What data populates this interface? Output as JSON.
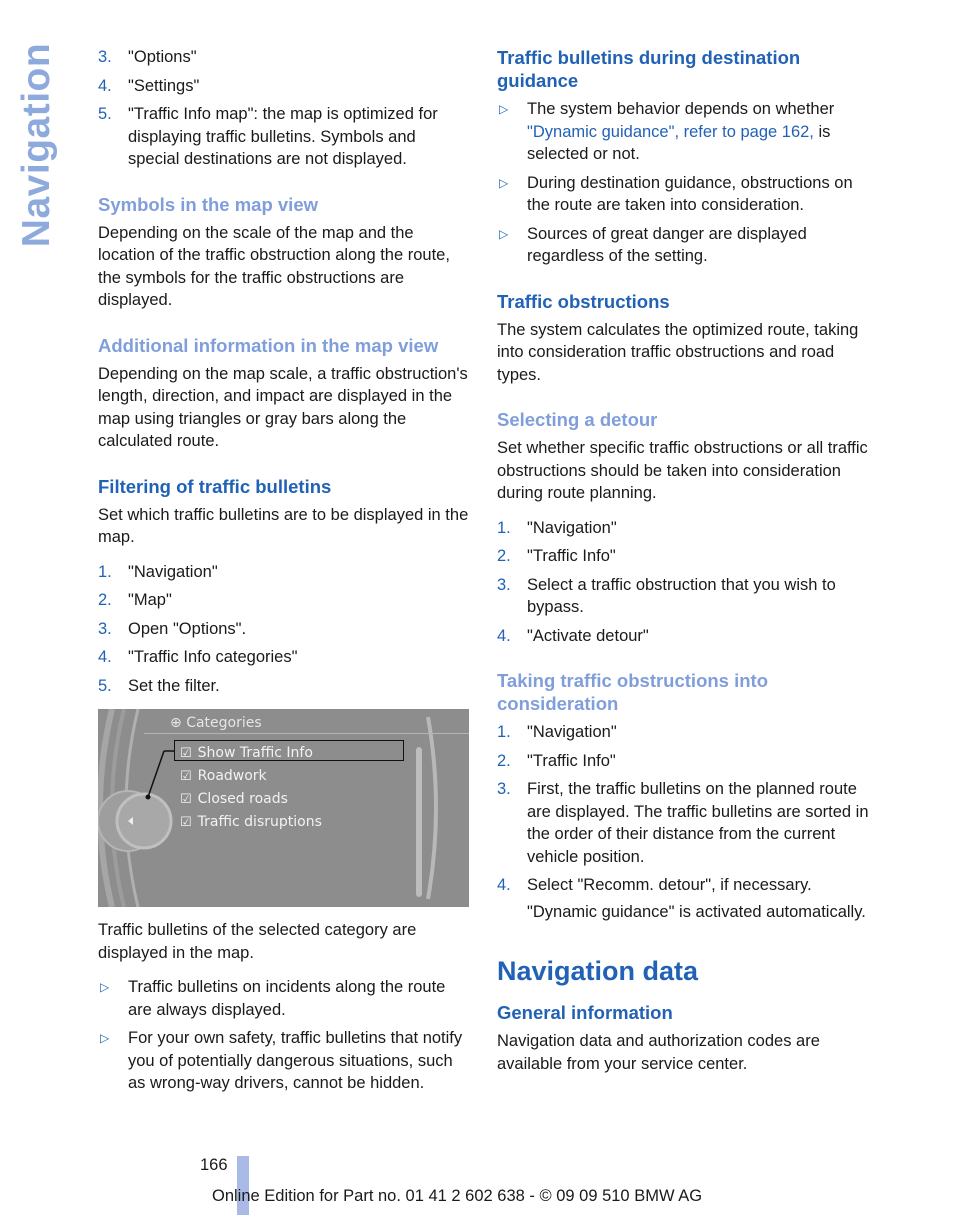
{
  "side_tab": "Navigation",
  "left": {
    "list_top": [
      {
        "num": "3.",
        "text": "\"Options\""
      },
      {
        "num": "4.",
        "text": "\"Settings\""
      },
      {
        "num": "5.",
        "text": "\"Traffic Info map\": the map is optimized for displaying traffic bulletins. Symbols and special destinations are not displayed."
      }
    ],
    "symbols_heading": "Symbols in the map view",
    "symbols_text": "Depending on the scale of the map and the location of the traffic obstruction along the route, the symbols for the traffic obstructions are displayed.",
    "additional_heading": "Additional information in the map view",
    "additional_text": "Depending on the map scale, a traffic obstruction's length, direction, and impact are displayed in the map using triangles or gray bars along the calculated route.",
    "filtering_heading": "Filtering of traffic bulletins",
    "filtering_text": "Set which traffic bulletins are to be displayed in the map.",
    "filter_steps": [
      {
        "num": "1.",
        "text": "\"Navigation\""
      },
      {
        "num": "2.",
        "text": "\"Map\""
      },
      {
        "num": "3.",
        "text": "Open \"Options\"."
      },
      {
        "num": "4.",
        "text": "\"Traffic Info categories\""
      },
      {
        "num": "5.",
        "text": "Set the filter."
      }
    ],
    "screen": {
      "title": "Categories",
      "items": [
        "Show Traffic Info",
        "Roadwork",
        "Closed roads",
        "Traffic disruptions"
      ]
    },
    "after_screen_text": "Traffic bulletins of the selected category are displayed in the map.",
    "bullets": [
      "Traffic bulletins on incidents along the route are always displayed.",
      "For your own safety, traffic bulletins that notify you of potentially dangerous situations, such as wrong-way drivers, cannot be hidden."
    ]
  },
  "right": {
    "guidance_heading": "Traffic bulletins during destination guidance",
    "guidance_b1_pre": "The system behavior depends on whether ",
    "guidance_b1_link": "\"Dynamic guidance\", refer to page 162,",
    "guidance_b1_post": " is selected or not.",
    "guidance_b2": "During destination guidance, obstructions on the route are taken into consideration.",
    "guidance_b3": "Sources of great danger are displayed regardless of the setting.",
    "obstructions_heading": "Traffic obstructions",
    "obstructions_text": "The system calculates the optimized route, taking into consideration traffic obstructions and road types.",
    "detour_heading": "Selecting a detour",
    "detour_text": "Set whether specific traffic obstructions or all traffic obstructions should be taken into consideration during route planning.",
    "detour_steps": [
      {
        "num": "1.",
        "text": "\"Navigation\""
      },
      {
        "num": "2.",
        "text": "\"Traffic Info\""
      },
      {
        "num": "3.",
        "text": "Select a traffic obstruction that you wish to bypass."
      },
      {
        "num": "4.",
        "text": "\"Activate detour\""
      }
    ],
    "taking_heading": "Taking traffic obstructions into consideration",
    "taking_steps": [
      {
        "num": "1.",
        "text": "\"Navigation\""
      },
      {
        "num": "2.",
        "text": "\"Traffic Info\""
      },
      {
        "num": "3.",
        "text": "First, the traffic bulletins on the planned route are displayed. The traffic bulletins are sorted in the order of their distance from the current vehicle position."
      },
      {
        "num": "4.",
        "text": "Select \"Recomm. detour\", if necessary."
      }
    ],
    "taking_note": "\"Dynamic guidance\" is activated automatically.",
    "navdata_heading": "Navigation data",
    "general_heading": "General information",
    "general_text": "Navigation data and authorization codes are available from your service center."
  },
  "footer": {
    "page_number": "166",
    "edition": "Online Edition for Part no. 01 41 2 602 638 - © 09 09 510 BMW AG"
  }
}
